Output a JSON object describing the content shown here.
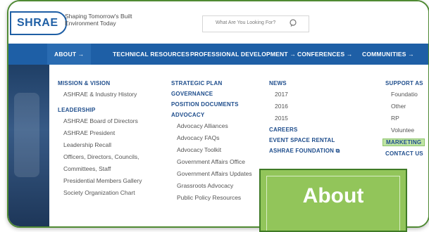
{
  "header": {
    "logo": "SHRAE",
    "tagline": "Shaping Tomorrow's Built Environment Today",
    "search_placeholder": "What Are You Looking For?"
  },
  "nav": {
    "items": [
      "ABOUT →",
      "TECHNICAL RESOURCES →",
      "PROFESSIONAL DEVELOPMENT →",
      "CONFERENCES →",
      "COMMUNITIES →"
    ]
  },
  "menu": {
    "col1": {
      "heading1": "MISSION & VISION",
      "link1": "ASHRAE & Industry History",
      "heading2": "LEADERSHIP",
      "links": [
        "ASHRAE Board of Directors",
        "ASHRAE President",
        "Leadership Recall",
        "Officers, Directors, Councils,",
        "Committees, Staff",
        "Presidential Members Gallery",
        "Society Organization Chart"
      ]
    },
    "col2": {
      "headings": [
        "STRATEGIC PLAN",
        "GOVERNANCE",
        "POSITION DOCUMENTS",
        "ADVOCACY"
      ],
      "links": [
        "Advocacy Alliances",
        "Advocacy FAQs",
        "Advocacy Toolkit",
        "Government Affairs Office",
        "Government Affairs Updates",
        "Grassroots Advocacy",
        "Public Policy Resources"
      ]
    },
    "col3": {
      "heading1": "NEWS",
      "years": [
        "2017",
        "2016",
        "2015"
      ],
      "heading2": "CAREERS",
      "heading3": "EVENT SPACE RENTAL",
      "heading4": "ASHRAE FOUNDATION",
      "ext_icon": "⧉"
    },
    "col4": {
      "heading1": "SUPPORT AS",
      "links": [
        "Foundatio",
        "Other",
        "RP",
        "Voluntee"
      ],
      "highlight": "MARKETING",
      "heading2": "CONTACT US"
    }
  },
  "callout": {
    "text": "About"
  },
  "colors": {
    "nav": "#1e5fa6",
    "frame": "#4f8a33",
    "callout": "#92c55a",
    "heading": "#1e4d8c"
  }
}
